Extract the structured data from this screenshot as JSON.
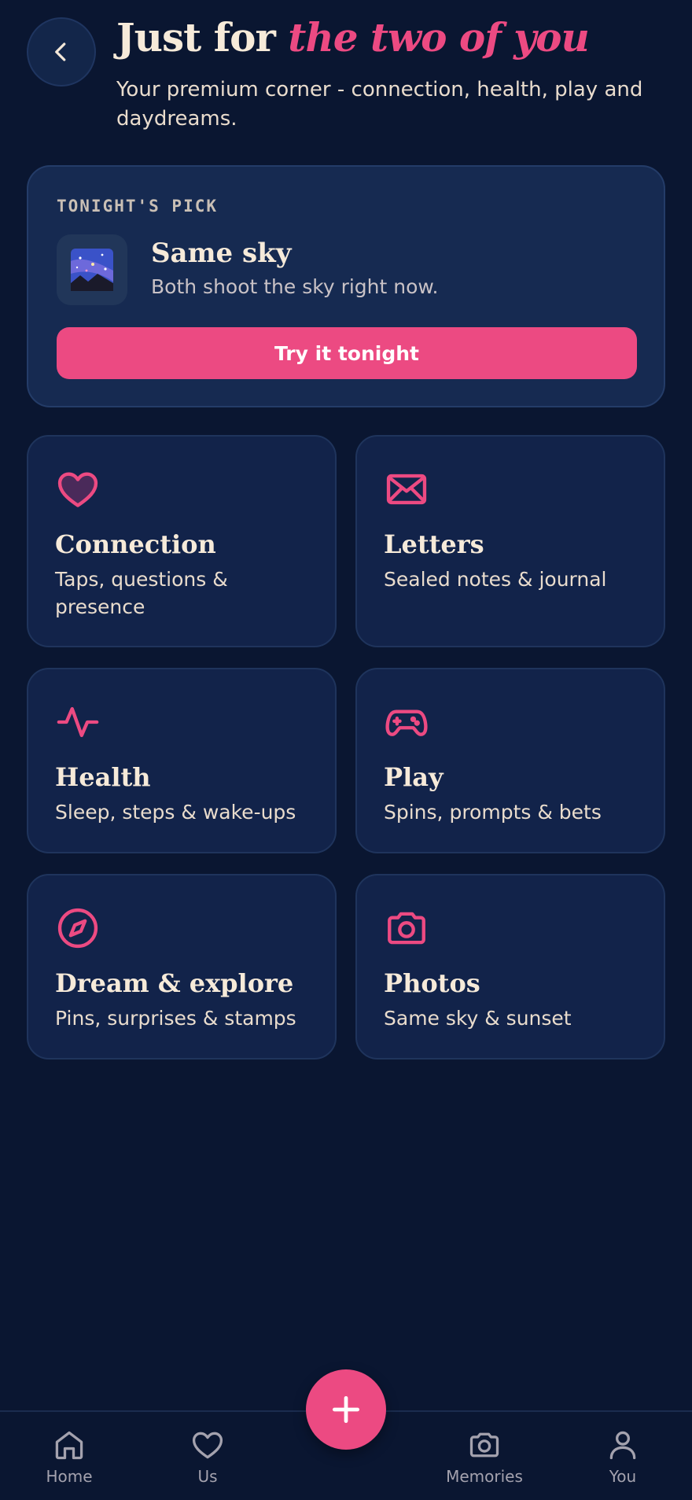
{
  "header": {
    "title_plain": "Just for",
    "title_accent": "the two of you",
    "subtitle": "Your premium corner - connection, health, play and daydreams."
  },
  "pick": {
    "eyebrow": "TONIGHT'S PICK",
    "name": "Same sky",
    "description": "Both shoot the sky right now.",
    "cta": "Try it tonight",
    "icon": "milky-way-icon"
  },
  "tiles": [
    {
      "icon": "heart-icon",
      "title": "Connection",
      "description": "Taps, questions & presence"
    },
    {
      "icon": "envelope-icon",
      "title": "Letters",
      "description": "Sealed notes & journal"
    },
    {
      "icon": "activity-icon",
      "title": "Health",
      "description": "Sleep, steps & wake-ups"
    },
    {
      "icon": "gamepad-icon",
      "title": "Play",
      "description": "Spins, prompts & bets"
    },
    {
      "icon": "compass-icon",
      "title": "Dream & explore",
      "description": "Pins, surprises & stamps"
    },
    {
      "icon": "camera-icon",
      "title": "Photos",
      "description": "Same sky & sunset"
    }
  ],
  "nav": {
    "items": [
      {
        "label": "Home",
        "icon": "home-icon"
      },
      {
        "label": "Us",
        "icon": "heart-icon"
      },
      {
        "label": "Memories",
        "icon": "camera-icon"
      },
      {
        "label": "You",
        "icon": "user-icon"
      }
    ],
    "fab_icon": "plus-icon"
  },
  "colors": {
    "background": "#0a1631",
    "card": "#162a51",
    "tile": "#12234a",
    "accent": "#ec4a82",
    "cream": "#f6ead9"
  }
}
